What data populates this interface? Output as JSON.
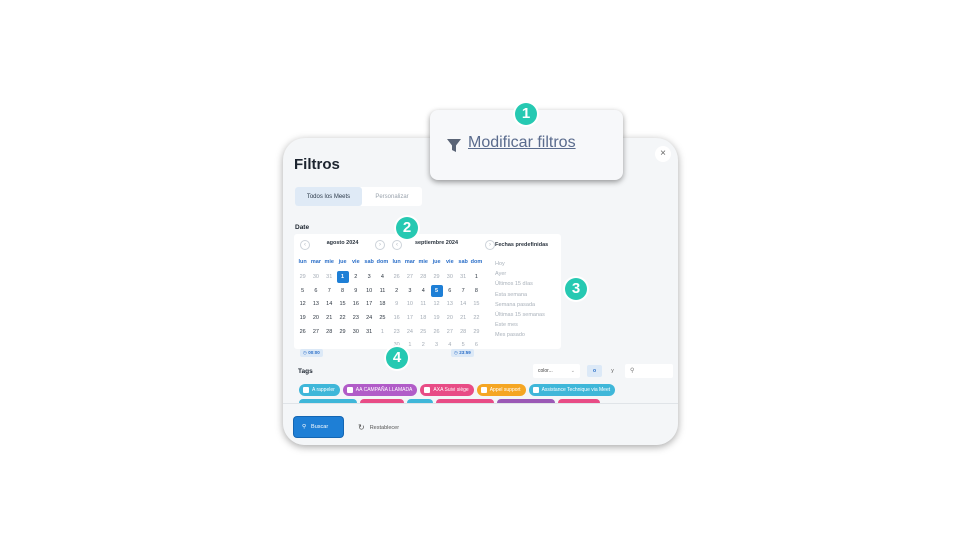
{
  "callout": {
    "text": "Modificar filtros"
  },
  "badges": [
    "1",
    "2",
    "3",
    "4"
  ],
  "filters": {
    "title": "Filtros",
    "close": "×",
    "tabs": [
      {
        "label": "Todos los Meets",
        "active": true
      },
      {
        "label": "Personalizar",
        "active": false
      }
    ],
    "date_label": "Date",
    "weekdays": [
      "lun",
      "mar",
      "mie",
      "jue",
      "vie",
      "sab",
      "dom"
    ],
    "calendars": [
      {
        "month": "agosto 2024",
        "days": [
          {
            "d": "29",
            "m": true
          },
          {
            "d": "30",
            "m": true
          },
          {
            "d": "31",
            "m": true
          },
          {
            "d": "1",
            "sel": true
          },
          {
            "d": "2"
          },
          {
            "d": "3"
          },
          {
            "d": "4"
          },
          {
            "d": "5"
          },
          {
            "d": "6"
          },
          {
            "d": "7"
          },
          {
            "d": "8"
          },
          {
            "d": "9"
          },
          {
            "d": "10"
          },
          {
            "d": "11"
          },
          {
            "d": "12"
          },
          {
            "d": "13"
          },
          {
            "d": "14"
          },
          {
            "d": "15"
          },
          {
            "d": "16"
          },
          {
            "d": "17"
          },
          {
            "d": "18"
          },
          {
            "d": "19"
          },
          {
            "d": "20"
          },
          {
            "d": "21"
          },
          {
            "d": "22"
          },
          {
            "d": "23"
          },
          {
            "d": "24"
          },
          {
            "d": "25"
          },
          {
            "d": "26"
          },
          {
            "d": "27"
          },
          {
            "d": "28"
          },
          {
            "d": "29"
          },
          {
            "d": "30"
          },
          {
            "d": "31"
          },
          {
            "d": "1",
            "m": true
          }
        ]
      },
      {
        "month": "septiembre 2024",
        "days": [
          {
            "d": "26",
            "m": true
          },
          {
            "d": "27",
            "m": true
          },
          {
            "d": "28",
            "m": true
          },
          {
            "d": "29",
            "m": true
          },
          {
            "d": "30",
            "m": true
          },
          {
            "d": "31",
            "m": true
          },
          {
            "d": "1"
          },
          {
            "d": "2"
          },
          {
            "d": "3"
          },
          {
            "d": "4"
          },
          {
            "d": "5",
            "sel": true
          },
          {
            "d": "6"
          },
          {
            "d": "7"
          },
          {
            "d": "8"
          },
          {
            "d": "9",
            "m": true
          },
          {
            "d": "10",
            "m": true
          },
          {
            "d": "11",
            "m": true
          },
          {
            "d": "12",
            "m": true
          },
          {
            "d": "13",
            "m": true
          },
          {
            "d": "14",
            "m": true
          },
          {
            "d": "15",
            "m": true
          },
          {
            "d": "16",
            "m": true
          },
          {
            "d": "17",
            "m": true
          },
          {
            "d": "18",
            "m": true
          },
          {
            "d": "19",
            "m": true
          },
          {
            "d": "20",
            "m": true
          },
          {
            "d": "21",
            "m": true
          },
          {
            "d": "22",
            "m": true
          },
          {
            "d": "23",
            "m": true
          },
          {
            "d": "24",
            "m": true
          },
          {
            "d": "25",
            "m": true
          },
          {
            "d": "26",
            "m": true
          },
          {
            "d": "27",
            "m": true
          },
          {
            "d": "28",
            "m": true
          },
          {
            "d": "29",
            "m": true
          },
          {
            "d": "30",
            "m": true
          },
          {
            "d": "1",
            "m": true
          },
          {
            "d": "2",
            "m": true
          },
          {
            "d": "3",
            "m": true
          },
          {
            "d": "4",
            "m": true
          },
          {
            "d": "5",
            "m": true
          },
          {
            "d": "6",
            "m": true
          }
        ]
      }
    ],
    "presets_title": "Fechas predefinidas",
    "presets": [
      "Hoy",
      "Ayer",
      "Últimos 15 días",
      "Esta semana",
      "Semana pasada",
      "Últimas 15 semanas",
      "Este mes",
      "Mes pasado"
    ],
    "time_start": "00:00",
    "time_end": "23:59",
    "tags_label": "Tags",
    "color_placeholder": "color...",
    "toggle_o": "o",
    "toggle_y": "y",
    "tags": [
      {
        "label": "A rappeler",
        "color": "#3fb7d9"
      },
      {
        "label": "AA CAMPAÑA LLAMADA",
        "color": "#b15cc8"
      },
      {
        "label": "AXA Suivi siège",
        "color": "#e84c86"
      },
      {
        "label": "Appel support",
        "color": "#f5a623"
      },
      {
        "label": "Assistance Technique via Meet",
        "color": "#3fb7d9"
      }
    ],
    "tags_row2_colors": [
      "#3fb7d9",
      "#e84c86",
      "#3fb7d9",
      "#e84c86",
      "#9b59b6",
      "#e84c86"
    ],
    "search_label": "Buscar",
    "reset_label": "Restablecer"
  }
}
